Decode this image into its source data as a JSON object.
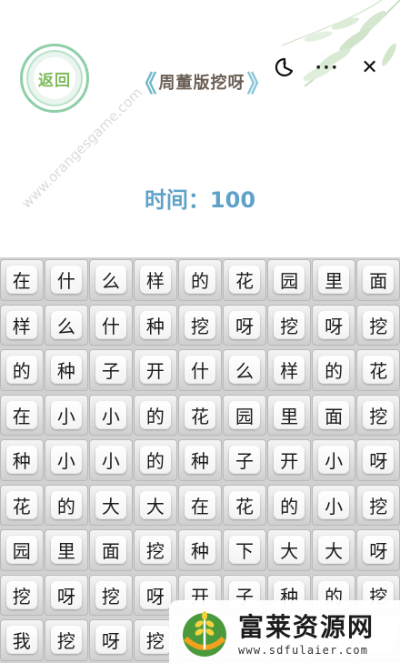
{
  "header": {
    "back_label": "返回",
    "title": "周董版挖呀",
    "chevron_left": "《",
    "chevron_right": "》"
  },
  "capsule": {
    "more_glyph": "···",
    "close_glyph": "✕"
  },
  "watermark": {
    "text": "www.orangesgame.com"
  },
  "timer": {
    "text": "时间：100"
  },
  "board": {
    "rows": [
      [
        "在",
        "什",
        "么",
        "样",
        "的",
        "花",
        "园",
        "里",
        "面"
      ],
      [
        "样",
        "么",
        "什",
        "种",
        "挖",
        "呀",
        "挖",
        "呀",
        "挖"
      ],
      [
        "的",
        "种",
        "子",
        "开",
        "什",
        "么",
        "样",
        "的",
        "花"
      ],
      [
        "在",
        "小",
        "小",
        "的",
        "花",
        "园",
        "里",
        "面",
        "挖"
      ],
      [
        "种",
        "小",
        "小",
        "的",
        "种",
        "子",
        "开",
        "小",
        "呀"
      ],
      [
        "花",
        "的",
        "大",
        "大",
        "在",
        "花",
        "的",
        "小",
        "挖"
      ],
      [
        "园",
        "里",
        "面",
        "挖",
        "种",
        "下",
        "大",
        "大",
        "呀"
      ],
      [
        "挖",
        "呀",
        "挖",
        "呀",
        "开",
        "子",
        "种",
        "的",
        "挖"
      ],
      [
        "我",
        "挖",
        "呀",
        "挖",
        "",
        "",
        "",
        "",
        ""
      ]
    ]
  },
  "logo": {
    "name": "富莱资源网",
    "url": "www.sdfulaier.com"
  },
  "colors": {
    "timer": "#5fa2c9",
    "title": "#6a5f55",
    "back_ring": "#8fcfa9",
    "back_text": "#7dbb5a"
  }
}
